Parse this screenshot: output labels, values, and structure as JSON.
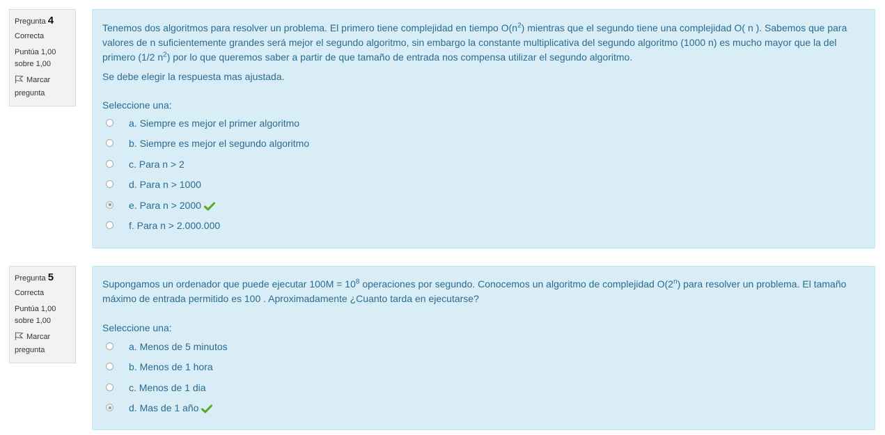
{
  "questions": [
    {
      "number_prefix": "Pregunta",
      "number": "4",
      "state": "Correcta",
      "grade_line1": "Puntúa 1,00",
      "grade_line2": "sobre 1,00",
      "flag_line1": "Marcar",
      "flag_line2": "pregunta",
      "text": {
        "p1_a": "Tenemos dos algoritmos para resolver un problema. El primero tiene complejidad en tiempo O(n",
        "p1_sup1": "2",
        "p1_b": ") mientras que el segundo tiene una complejidad O( n ). Sabemos que para valores de n suficientemente grandes será mejor el segundo algoritmo, sin embargo la constante multiplicativa del segundo algoritmo (1000 n) es mucho mayor que la del primero (1/2 n",
        "p1_sup2": "2",
        "p1_c": ") por lo que queremos saber a partir de que tamaño de entrada nos compensa utilizar el segundo algoritmo.",
        "p2": "Se debe elegir la respuesta mas ajustada."
      },
      "prompt": "Seleccione una:",
      "options": [
        {
          "label": "a. Siempre es mejor el primer algoritmo",
          "selected": false,
          "correct": false
        },
        {
          "label": "b. Siempre es mejor el segundo algoritmo",
          "selected": false,
          "correct": false
        },
        {
          "label": "c. Para n > 2",
          "selected": false,
          "correct": false
        },
        {
          "label": "d. Para n > 1000",
          "selected": false,
          "correct": false
        },
        {
          "label": "e. Para n > 2000",
          "selected": true,
          "correct": true
        },
        {
          "label": "f. Para n > 2.000.000",
          "selected": false,
          "correct": false
        }
      ]
    },
    {
      "number_prefix": "Pregunta",
      "number": "5",
      "state": "Correcta",
      "grade_line1": "Puntúa 1,00",
      "grade_line2": "sobre 1,00",
      "flag_line1": "Marcar",
      "flag_line2": "pregunta",
      "text": {
        "p1_a": "Supongamos un ordenador que puede ejecutar 100M = 10",
        "p1_sup1": "8",
        "p1_b": " operaciones por segundo. Conocemos un algoritmo de complejidad O(2",
        "p1_sup2": "n",
        "p1_c": ") para resolver un problema. El tamaño máximo de entrada permitido es 100 . Aproximadamente ¿Cuanto tarda en ejecutarse?"
      },
      "prompt": "Seleccione una:",
      "options": [
        {
          "label": "a. Menos de 5 minutos",
          "selected": false,
          "correct": false
        },
        {
          "label": "b. Menos de 1 hora",
          "selected": false,
          "correct": false
        },
        {
          "label": "c. Menos de 1 dia",
          "selected": false,
          "correct": false
        },
        {
          "label": "d. Mas de 1 año",
          "selected": true,
          "correct": true
        }
      ]
    }
  ],
  "colors": {
    "text": "#2a6b90",
    "panel": "#d9edf7",
    "check": "#5aa81b"
  }
}
